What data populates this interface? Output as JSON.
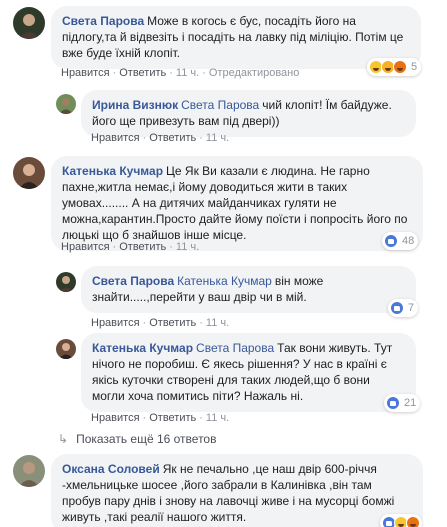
{
  "actions": {
    "like": "Нравится",
    "reply": "Ответить",
    "edited": "Отредактировано"
  },
  "comments": [
    {
      "author": "Света Парова",
      "text": "Може в когось є бус, посадіть його на підлогу,та й відвезіть і посадіть на лавку під міліцію. Потім це вже буде їхній клопіт.",
      "time": "11 ч.",
      "reaction_count": "5"
    },
    {
      "author": "Ирина Визнюк",
      "mention": "Света Парова",
      "text": "чий клопіт! Їм байдуже. його ще привезуть вам під двері))",
      "time": "11 ч."
    },
    {
      "author": "Катенька Кучмар",
      "text": "Це Як Ви казали є людина. Не гарно пахне,житла немає,і йому доводиться жити в таких умовах........ А на дитячих майданчиках гуляти не можна,карантин.Просто дайте йому поїсти і попросіть його по люцькі що б знайшов інше місце.",
      "time": "11 ч.",
      "reaction_count": "48"
    },
    {
      "author": "Света Парова",
      "mention": "Катенька Кучмар",
      "text": "він може знайти.....,перейти у ваш двір чи в мій.",
      "time": "11 ч.",
      "reaction_count": "7"
    },
    {
      "author": "Катенька Кучмар",
      "mention": "Света Парова",
      "text": "Так вони живуть. Тут нічого не поробиш. Є якесь рішення? У нас в країні є якісь куточки створені для таких людей,що б вони могли хоча помитись піти? Нажаль ні.",
      "time": "11 ч.",
      "reaction_count": "21"
    },
    {
      "author": "Оксана Соловей",
      "text": "Як не печально ,це наш двір 600-річчя -хмельницьке шосее ,його забрали в Калинівка ,він там пробув пару днів і знову на лавочці живе і на мусорці бомжі живуть ,такі реалії нашого життя."
    }
  ],
  "more_replies": "Показать ещё 16 ответов",
  "colors": {
    "link": "#385898",
    "bubble": "#f2f3f5",
    "meta": "#90949c",
    "like": "#4a78d8"
  }
}
